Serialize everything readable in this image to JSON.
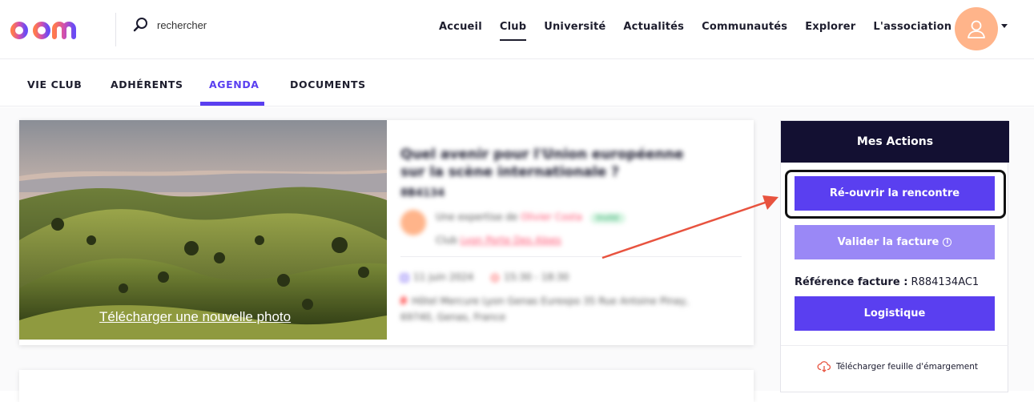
{
  "header": {
    "search_placeholder": "rechercher",
    "nav": [
      {
        "label": "Accueil",
        "active": false
      },
      {
        "label": "Club",
        "active": true
      },
      {
        "label": "Université",
        "active": false
      },
      {
        "label": "Actualités",
        "active": false
      },
      {
        "label": "Communautés",
        "active": false
      },
      {
        "label": "Explorer",
        "active": false
      },
      {
        "label": "L'association",
        "active": false
      }
    ]
  },
  "subnav": {
    "items": [
      {
        "label": "VIE CLUB"
      },
      {
        "label": "ADHÉRENTS"
      },
      {
        "label": "AGENDA",
        "active": true
      },
      {
        "label": "DOCUMENTS"
      }
    ]
  },
  "event": {
    "photo_link": "Télécharger une nouvelle photo",
    "title": "Quel avenir pour l'Union européenne sur la scène internationale ?",
    "code": "8B4134",
    "expert_prefix": "Une expertise de",
    "expert_name": "Olivier Costa",
    "expert_tag": "Invité",
    "club_prefix": "Club",
    "club_name": "Lyon Porte Des Alpes",
    "date": "11 juin 2024",
    "time": "15:30 - 18:30",
    "place": "Hôtel Mercure Lyon Genas Eurexpo 35 Rue Antoine Pinay, 69740, Genas, France"
  },
  "actions": {
    "header": "Mes Actions",
    "reopen": "Ré-ouvrir la rencontre",
    "validate": "Valider la facture",
    "ref_label": "Référence facture :",
    "ref_value": "R884134AC1",
    "logistics": "Logistique",
    "download": "Télécharger feuille d'émargement"
  },
  "colors": {
    "accent": "#5a3ff0",
    "dark_header": "#131032",
    "avatar": "#ffb48a",
    "arrow": "#e8533f"
  }
}
